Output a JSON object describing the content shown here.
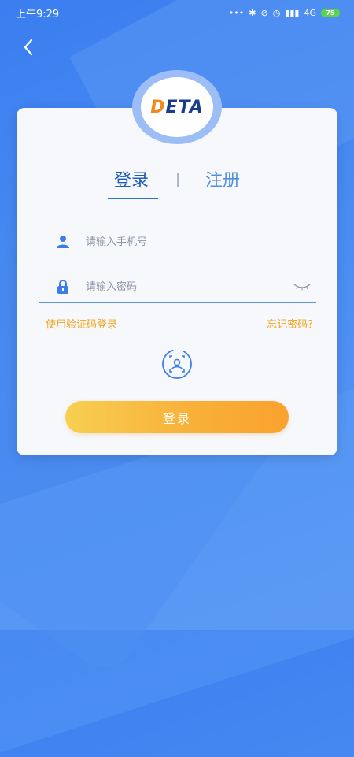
{
  "status_bar": {
    "time": "上午9:29",
    "network": "4G",
    "battery": "75"
  },
  "logo": {
    "text_prefix": "D",
    "text_rest": "ETA"
  },
  "tabs": {
    "login": "登录",
    "separator": "|",
    "register": "注册"
  },
  "form": {
    "phone_placeholder": "请输入手机号",
    "password_placeholder": "请输入密码"
  },
  "links": {
    "sms_login": "使用验证码登录",
    "forgot_password": "忘记密码?"
  },
  "button": {
    "login_label": "登录"
  },
  "colors": {
    "accent_blue": "#2d6fd0",
    "link_orange": "#f2a51e",
    "button_gradient_start": "#f7cf52",
    "button_gradient_end": "#f9a22e"
  }
}
